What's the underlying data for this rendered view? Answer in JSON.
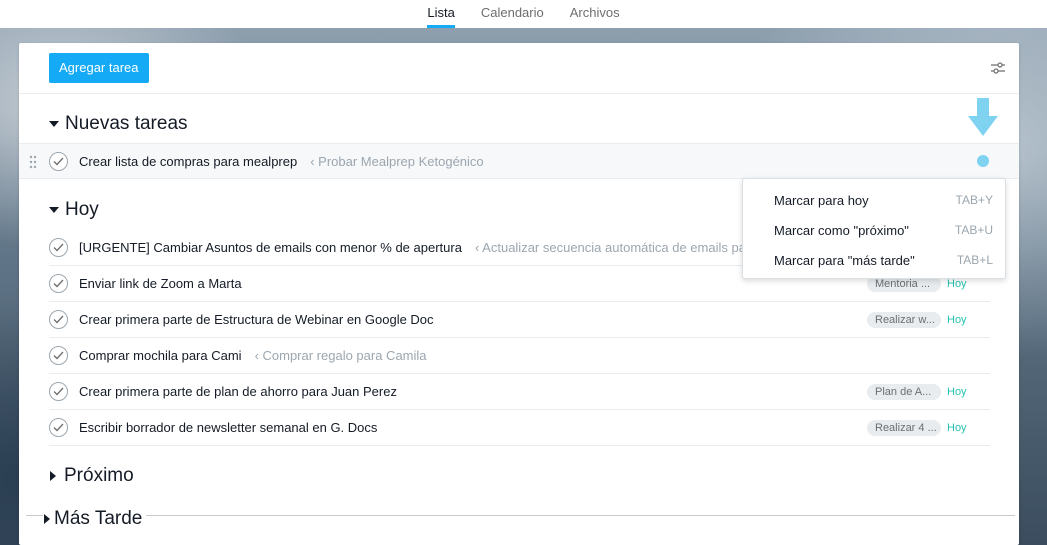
{
  "nav": {
    "tabs": [
      {
        "label": "Lista",
        "active": true
      },
      {
        "label": "Calendario",
        "active": false
      },
      {
        "label": "Archivos",
        "active": false
      }
    ]
  },
  "toolbar": {
    "add_label": "Agregar tarea",
    "filter_icon": "sliders-icon"
  },
  "sections": {
    "nuevas": {
      "title": "Nuevas tareas",
      "tasks": [
        {
          "name": "Crear lista de compras para mealprep",
          "parent": "‹ Probar Mealprep Ketogénico"
        }
      ]
    },
    "hoy": {
      "title": "Hoy",
      "tasks": [
        {
          "name": "[URGENTE] Cambiar Asuntos de emails con menor % de apertura",
          "parent": "‹ Actualizar secuencia automática de emails para",
          "tag": "",
          "due": ""
        },
        {
          "name": "Enviar link de Zoom a Marta",
          "parent": "",
          "tag": "Mentoria ...",
          "due": "Hoy"
        },
        {
          "name": "Crear primera parte de Estructura de Webinar en Google Doc",
          "parent": "",
          "tag": "Realizar w...",
          "due": "Hoy"
        },
        {
          "name": "Comprar mochila para Cami",
          "parent": "‹ Comprar regalo para Camila",
          "tag": "",
          "due": ""
        },
        {
          "name": "Crear primera parte de plan de ahorro para Juan Perez",
          "parent": "",
          "tag": "Plan de A...",
          "due": "Hoy"
        },
        {
          "name": "Escribir borrador de newsletter semanal en G. Docs",
          "parent": "",
          "tag": "Realizar 4 ...",
          "due": "Hoy"
        }
      ]
    },
    "proximo": {
      "title": "Próximo"
    },
    "mas_tarde": {
      "title": "Más Tarde"
    }
  },
  "menu": {
    "items": [
      {
        "label": "Marcar para hoy",
        "key": "TAB+Y"
      },
      {
        "label": "Marcar como \"próximo\"",
        "key": "TAB+U"
      },
      {
        "label": "Marcar para \"más tarde\"",
        "key": "TAB+L"
      }
    ]
  },
  "colors": {
    "accent": "#14aaf5",
    "due_today": "#25c2b0",
    "indicator": "#7fd3f0"
  }
}
